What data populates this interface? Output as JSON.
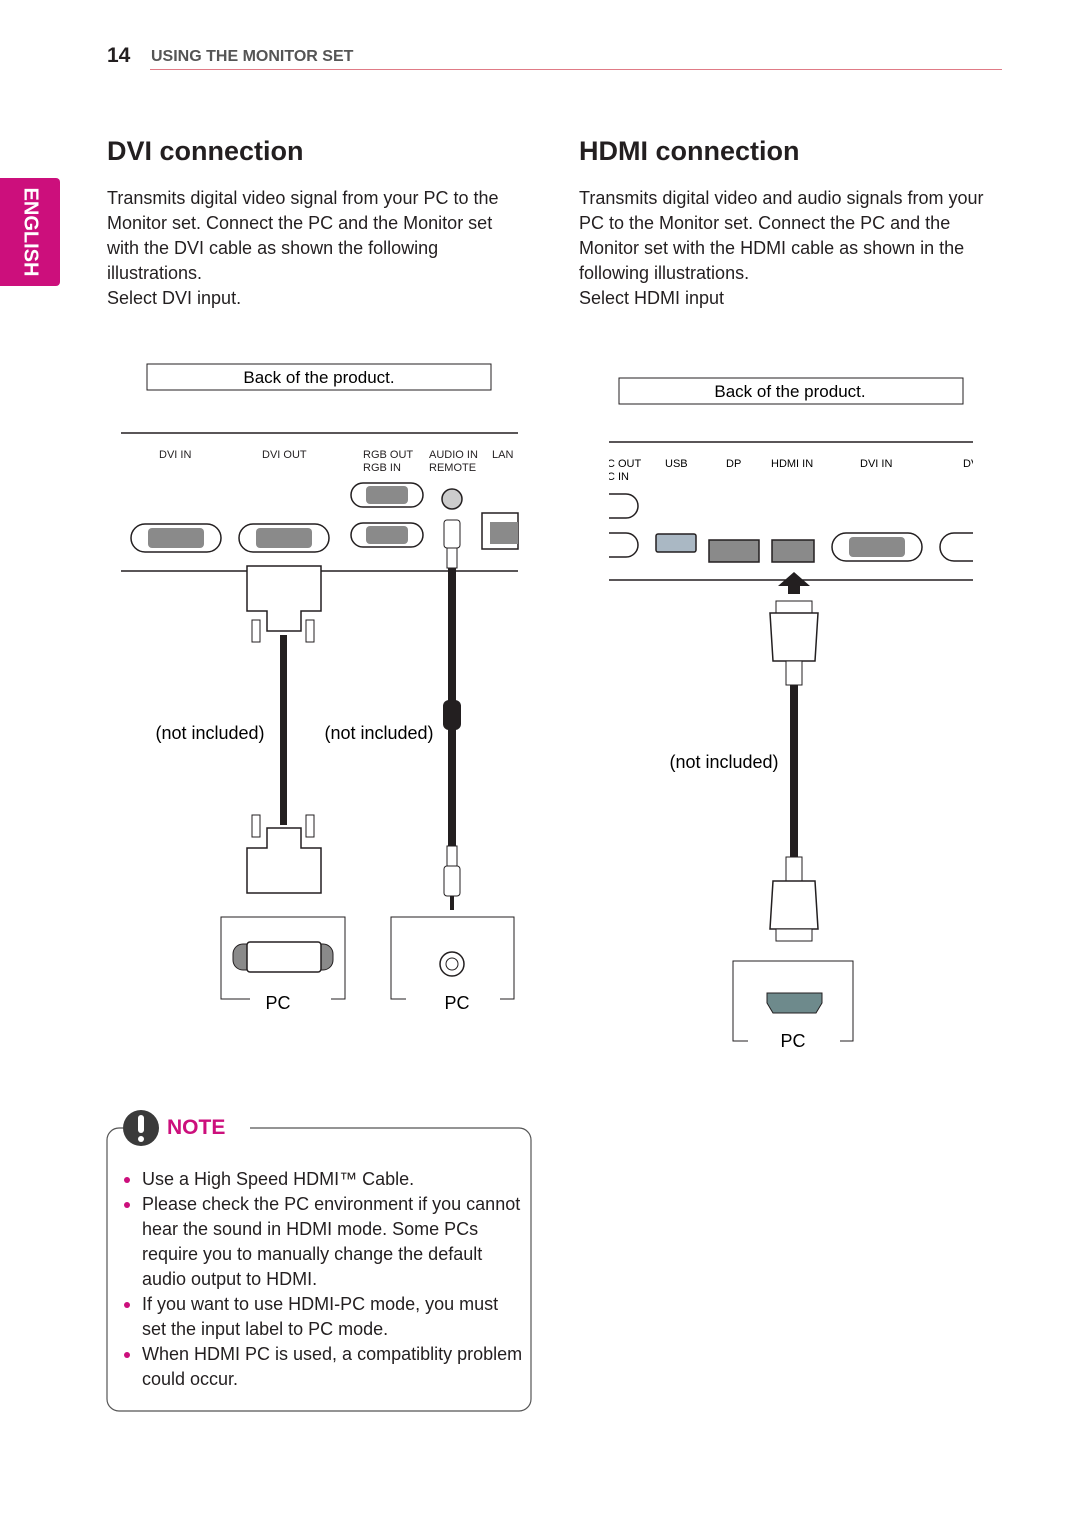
{
  "header": {
    "page_number": "14",
    "section_title": "USING THE MONITOR SET"
  },
  "side_tab": {
    "label": "ENGLISH"
  },
  "dvi": {
    "title": "DVI connection",
    "paragraph": "Transmits digital video signal from your PC to the Monitor set. Connect the PC and the Monitor set with the DVI cable as shown the following illustrations.",
    "instruction": "Select DVI input.",
    "diagram": {
      "back_label": "Back of the product.",
      "ports": {
        "dvi_in": "DVI IN",
        "dvi_out": "DVI OUT",
        "rgb_out": "RGB OUT",
        "rgb_in": "RGB IN",
        "audio_in": "AUDIO IN",
        "remote": "REMOTE",
        "lan": "LAN"
      },
      "cable1_note": "(not included)",
      "cable2_note": "(not included)",
      "pc1": "PC",
      "pc2": "PC"
    }
  },
  "hdmi": {
    "title": "HDMI connection",
    "paragraph": "Transmits digital video and audio signals from your PC to the Monitor set. Connect the PC and the Monitor set with the HDMI cable as shown in the following illustrations.",
    "instruction": "Select HDMI input",
    "diagram": {
      "back_label": "Back of the product.",
      "ports": {
        "rgb_out_partial": "C OUT",
        "rgb_in_partial": "C IN",
        "usb": "USB",
        "dp": "DP",
        "hdmi_in": "HDMI IN",
        "dvi_in": "DVI IN",
        "dvi_partial": "DVI"
      },
      "cable_note": "(not included)",
      "pc": "PC"
    }
  },
  "note": {
    "title": "NOTE",
    "icon": "exclamation-icon",
    "items": [
      "Use a High Speed HDMI™ Cable.",
      "Please check the PC environment if you cannot hear the sound in HDMI mode. Some PCs require you to manually change the default audio output to HDMI.",
      "If you want to use HDMI-PC mode, you must set the input label to PC mode.",
      "When HDMI PC is used, a compatiblity problem could occur."
    ]
  },
  "colors": {
    "accent": "#cc0f7c",
    "rule": "#e07b86",
    "port_fill": "#8a8a8a"
  }
}
